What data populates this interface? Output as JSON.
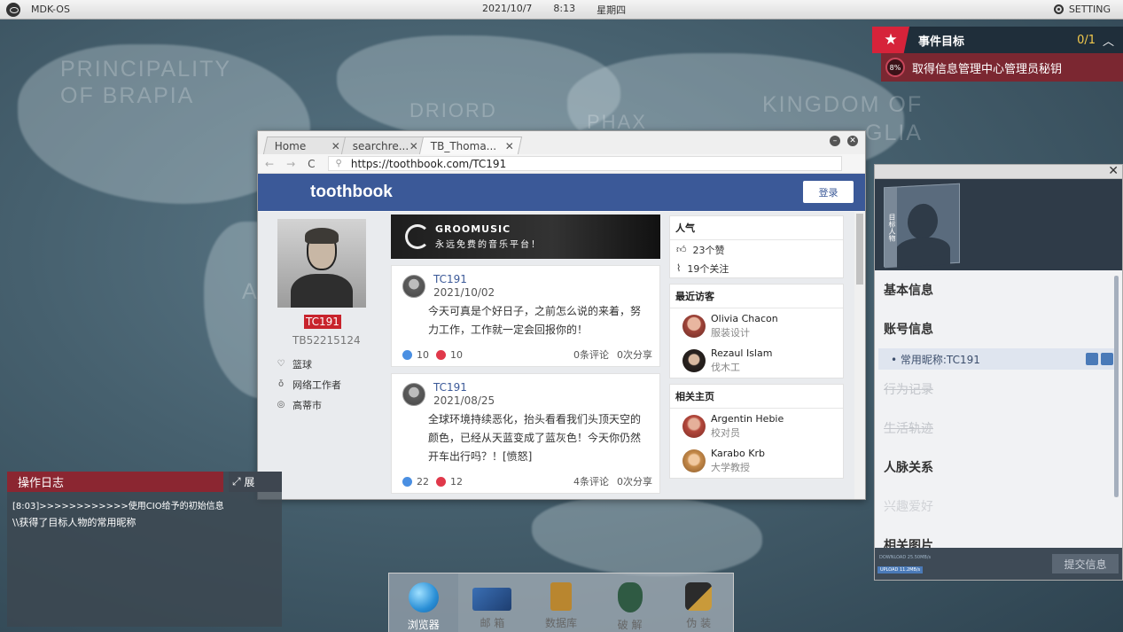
{
  "topbar": {
    "os_name": "MDK-OS",
    "date": "2021/10/7",
    "time": "8:13",
    "weekday": "星期四",
    "setting": "SETTING"
  },
  "map": {
    "labels": [
      "PRINCIPALITY",
      "OF BRAPIA",
      "DRIORD",
      "PHAX",
      "KINGDOM OF",
      "GLIA",
      "A"
    ]
  },
  "goal": {
    "title": "事件目标",
    "count": "0/1",
    "progress": "8%",
    "task": "取得信息管理中心管理员秘钥"
  },
  "browser": {
    "tabs": [
      {
        "label": "Home",
        "close": "✕"
      },
      {
        "label": "searchre...",
        "close": "✕"
      },
      {
        "label": "TB_Thoma...",
        "close": "✕"
      }
    ],
    "url": "https://toothbook.com/TC191",
    "site_name": "toothbook",
    "login": "登录"
  },
  "profile": {
    "name": "TC191",
    "id": "TB52215124",
    "info": [
      "篮球",
      "网络工作者",
      "高蒂市"
    ]
  },
  "ad": {
    "title": "GROOMUSIC",
    "subtitle": "永远免费的音乐平台！"
  },
  "posts": [
    {
      "name": "TC191",
      "date": "2021/10/02",
      "text": "今天可真是个好日子，之前怎么说的来着，努力工作，工作就一定会回报你的！",
      "likes": "10",
      "hearts": "10",
      "comments": "0条评论",
      "shares": "0次分享"
    },
    {
      "name": "TC191",
      "date": "2021/08/25",
      "text": "全球环境持续恶化，抬头看看我们头顶天空的颜色，已经从天蓝变成了蓝灰色！今天你仍然开车出行吗？！[愤怒]",
      "likes": "22",
      "hearts": "12",
      "comments": "4条评论",
      "shares": "0次分享"
    }
  ],
  "sidebar": {
    "popularity_title": "人气",
    "likes": "23个赞",
    "follows": "19个关注",
    "visitors_title": "最近访客",
    "visitors": [
      {
        "name": "Olivia Chacon",
        "role": "服装设计"
      },
      {
        "name": "Rezaul Islam",
        "role": "伐木工"
      }
    ],
    "pages_title": "相关主页",
    "pages": [
      {
        "name": "Argentin Hebie",
        "role": "校对员"
      },
      {
        "name": "Karabo Krb",
        "role": "大学教授"
      }
    ]
  },
  "rpanel": {
    "photo_label": "目标人物",
    "sections": [
      "基本信息",
      "账号信息",
      "行为记录",
      "生活轨迹",
      "人脉关系",
      "兴趣爱好",
      "相关图片"
    ],
    "account_item": "• 常用昵称:TC191",
    "download": "DOWNLOAD 25.50MB/s",
    "upload": "UPLOAD 11.2MB/s",
    "submit": "提交信息"
  },
  "log": {
    "title": "操作日志",
    "expand": "展",
    "lines": [
      "[8:03]>>>>>>>>>>>>使用CIO给予的初始信息",
      "\\\\获得了目标人物的常用昵称"
    ]
  },
  "dock": [
    "浏览器",
    "邮 箱",
    "数据库",
    "破 解",
    "伪 装"
  ]
}
